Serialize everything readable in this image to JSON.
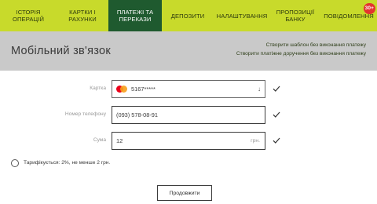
{
  "nav": {
    "items": [
      {
        "label": "Історія операцій",
        "active": false
      },
      {
        "label": "Картки і рахунки",
        "active": false
      },
      {
        "label": "Платежі та перекази",
        "active": true
      },
      {
        "label": "Депозити",
        "active": false
      },
      {
        "label": "Налаштування",
        "active": false
      },
      {
        "label": "Пропозиції банку",
        "active": false
      },
      {
        "label": "Повідомлення",
        "active": false,
        "badge": "30+"
      }
    ]
  },
  "header": {
    "title": "Мобільний зв'язок",
    "links": [
      "Створити шаблон без виконання платежу",
      "Створити платіжне доручення без виконання платежу"
    ]
  },
  "form": {
    "card": {
      "label": "Картка",
      "value": "5167*****",
      "icon": "mastercard-icon",
      "arrow": "↓"
    },
    "phone": {
      "label": "Номер телефону",
      "value": "(093) 578-08-91"
    },
    "amount": {
      "label": "Сума",
      "value": "12",
      "currency": "грн."
    }
  },
  "tariff_text": "Тарифікується: 2%, не менше 2 грн.",
  "submit_label": "Продовжити",
  "colors": {
    "nav_bg": "#c8da2b",
    "nav_active": "#1f5a2f",
    "header_bg": "#c9c9c9",
    "badge": "#e3342f"
  }
}
